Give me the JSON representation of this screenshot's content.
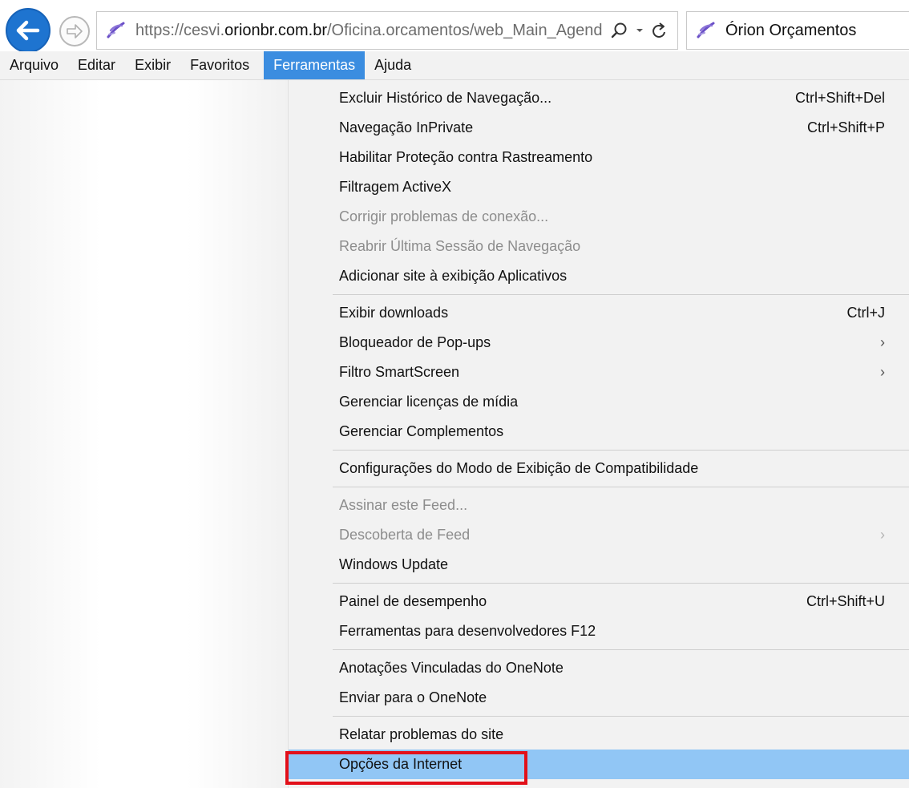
{
  "browser": {
    "url_prefix": "https://cesvi.",
    "url_host": "orionbr.com.br",
    "url_path": "/Oficina.orcamentos/web_Main_Agend",
    "search_icon": "search-icon",
    "dropdown_icon": "chevron-down-icon",
    "refresh_icon": "refresh-icon",
    "tab_title": "Órion Orçamentos"
  },
  "menubar": {
    "items": [
      {
        "label": "Arquivo"
      },
      {
        "label": "Editar"
      },
      {
        "label": "Exibir"
      },
      {
        "label": "Favoritos"
      },
      {
        "label": "Ferramentas",
        "active": true
      },
      {
        "label": "Ajuda"
      }
    ]
  },
  "menu": {
    "groups": [
      [
        {
          "label": "Excluir Histórico de Navegação...",
          "shortcut": "Ctrl+Shift+Del"
        },
        {
          "label": "Navegação InPrivate",
          "shortcut": "Ctrl+Shift+P"
        },
        {
          "label": "Habilitar Proteção contra Rastreamento"
        },
        {
          "label": "Filtragem ActiveX"
        },
        {
          "label": "Corrigir problemas de conexão...",
          "disabled": true
        },
        {
          "label": "Reabrir Última Sessão de Navegação",
          "disabled": true
        },
        {
          "label": "Adicionar site à exibição Aplicativos"
        }
      ],
      [
        {
          "label": "Exibir downloads",
          "shortcut": "Ctrl+J"
        },
        {
          "label": "Bloqueador de Pop-ups",
          "submenu": true
        },
        {
          "label": "Filtro SmartScreen",
          "submenu": true
        },
        {
          "label": "Gerenciar licenças de mídia"
        },
        {
          "label": "Gerenciar Complementos"
        }
      ],
      [
        {
          "label": "Configurações do Modo de Exibição de Compatibilidade"
        }
      ],
      [
        {
          "label": "Assinar este Feed...",
          "disabled": true
        },
        {
          "label": "Descoberta de Feed",
          "disabled": true,
          "submenu": true
        },
        {
          "label": "Windows Update"
        }
      ],
      [
        {
          "label": "Painel de desempenho",
          "shortcut": "Ctrl+Shift+U"
        },
        {
          "label": "Ferramentas para desenvolvedores F12"
        }
      ],
      [
        {
          "label": "Anotações Vinculadas do OneNote"
        },
        {
          "label": "Enviar para o OneNote"
        }
      ],
      [
        {
          "label": "Relatar problemas do site"
        },
        {
          "label": "Opções da Internet",
          "highlighted": true
        }
      ]
    ]
  },
  "colors": {
    "back_button": "#1e74d0",
    "menu_active": "#3b8de0",
    "row_highlight": "#91c6f5",
    "annotation_box": "#e2101a"
  }
}
